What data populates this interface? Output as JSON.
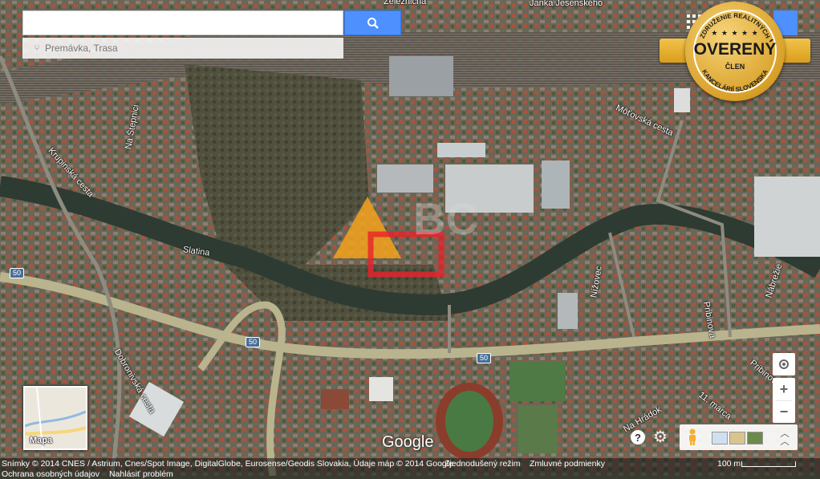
{
  "search": {
    "value": "",
    "directions_placeholder": "Premávka, Trasa"
  },
  "badge": {
    "arc_top": "ZDRUŽENIE REALITNÝCH",
    "arc_bottom": "KANCELÁRIÍ SLOVENSKA",
    "main": "OVERENÝ",
    "sub": "ČLEN",
    "accent": "#e0ac2c"
  },
  "map_labels": {
    "zeleznicna": "Železničná",
    "janka_jesenskeho": "Janka Jesenského",
    "krupinska": "Krupinská cesta",
    "na_stepnici": "Na Štepnici",
    "motovska": "Môťovská cesta",
    "slatina": "Slatina",
    "nabrezie": "Nábrežie",
    "pribinova": "Pribinova",
    "nizovec": "Nížovec",
    "dobronivska": "Dobronivská cesta",
    "pribinova2": "Pribinova",
    "marca": "11. marca",
    "na_hradok": "Na Hrádok"
  },
  "road_shields": [
    "50",
    "50",
    "50"
  ],
  "minimap": {
    "label": "Mapa"
  },
  "google_logo": "Google",
  "footer": {
    "attribution": "Snímky © 2014 CNES / Astrium, Cnes/Spot Image, DigitalGlobe, Eurosense/Geodis Slovakia, Údaje máp © 2014 Google",
    "simplified": "Zjednodušený režim",
    "terms": "Zmluvné podmienky",
    "privacy": "Ochrana osobných údajov",
    "report": "Nahlásiť problém",
    "scale": "100 m"
  },
  "icons": {
    "search": "search-icon",
    "directions": "directions-icon",
    "locate": "my-location-icon",
    "zoom_in": "plus-icon",
    "zoom_out": "minus-icon",
    "help": "help-icon",
    "settings": "gear-icon",
    "street_view": "pegman-icon",
    "expand": "chevron-up-icon"
  },
  "colors": {
    "search_blue": "#4d90fe",
    "watermark_orange": "#f3a21c",
    "watermark_red": "#e8202a"
  }
}
